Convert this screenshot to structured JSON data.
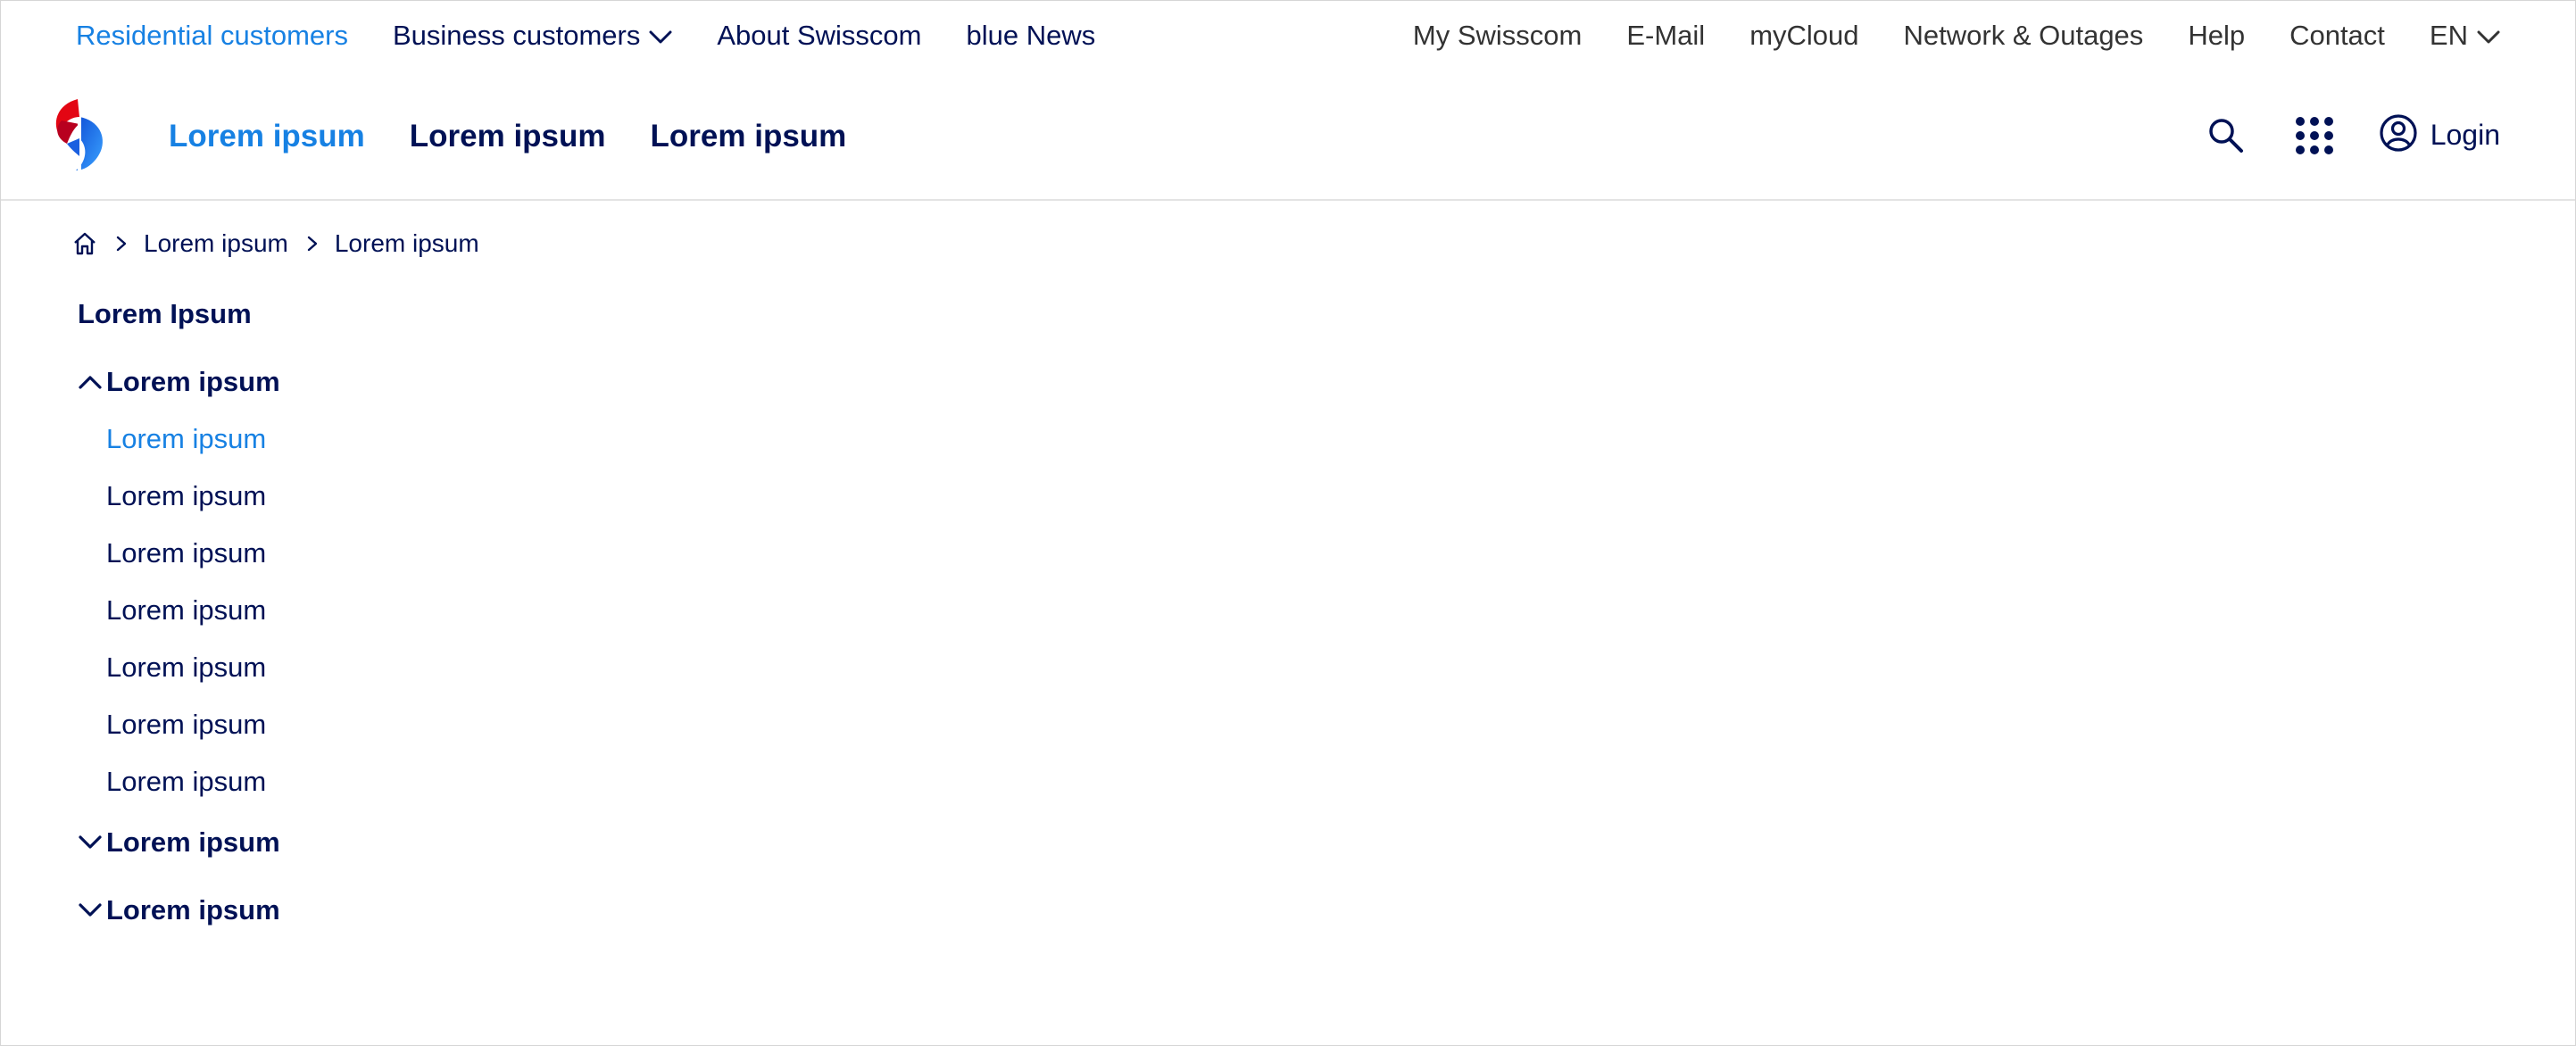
{
  "meta_nav": {
    "left": [
      {
        "label": "Residential customers",
        "active": true
      },
      {
        "label": "Business customers",
        "has_dropdown": true
      },
      {
        "label": "About Swisscom"
      },
      {
        "label": "blue News"
      }
    ],
    "right": [
      {
        "label": "My Swisscom"
      },
      {
        "label": "E-Mail"
      },
      {
        "label": "myCloud"
      },
      {
        "label": "Network & Outages"
      },
      {
        "label": "Help"
      },
      {
        "label": "Contact"
      },
      {
        "label": "EN",
        "has_dropdown": true
      }
    ]
  },
  "main_nav": {
    "items": [
      {
        "label": "Lorem ipsum",
        "active": true
      },
      {
        "label": "Lorem ipsum"
      },
      {
        "label": "Lorem ipsum"
      }
    ],
    "login_label": "Login",
    "icons": [
      "swisscom-logo",
      "search-icon",
      "apps-grid-icon",
      "user-circle-icon"
    ]
  },
  "breadcrumb": {
    "icons": [
      "home-icon",
      "chevron-right-icon"
    ],
    "items": [
      "Lorem ipsum",
      "Lorem ipsum"
    ]
  },
  "side_menu": {
    "title": "Lorem Ipsum",
    "groups": [
      {
        "label": "Lorem ipsum",
        "expanded": true,
        "items": [
          {
            "label": "Lorem ipsum",
            "active": true
          },
          {
            "label": "Lorem ipsum"
          },
          {
            "label": "Lorem ipsum"
          },
          {
            "label": "Lorem ipsum"
          },
          {
            "label": "Lorem ipsum"
          },
          {
            "label": "Lorem ipsum"
          },
          {
            "label": "Lorem ipsum"
          }
        ]
      },
      {
        "label": "Lorem ipsum",
        "expanded": false,
        "items": []
      },
      {
        "label": "Lorem ipsum",
        "expanded": false,
        "items": []
      }
    ]
  },
  "colors": {
    "text_primary": "#001155",
    "accent": "#1781e3",
    "secondary_text": "#333333",
    "divider": "#e3e3e3",
    "logo_red": "#e30613",
    "logo_blue": "#1781e3"
  }
}
